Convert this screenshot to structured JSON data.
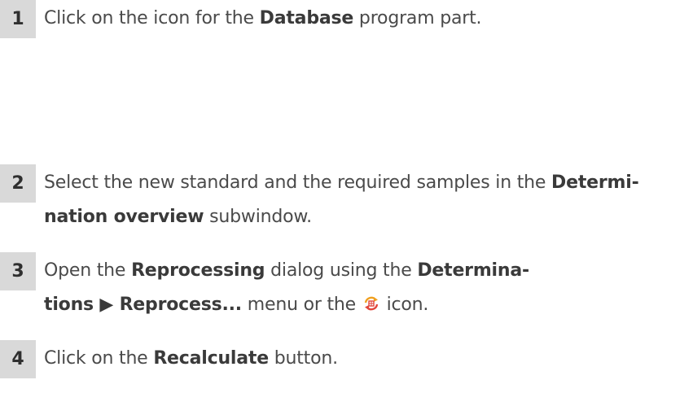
{
  "steps": [
    {
      "number": "1",
      "t1": "Click on the icon for the ",
      "b1": "Database",
      "t2": " program part."
    },
    {
      "number": "2",
      "t1": "Select the new standard and the required samples in the ",
      "b1": "Determi-",
      "b2": "nation overview",
      "t2": " subwindow."
    },
    {
      "number": "3",
      "t1": "Open the ",
      "b1": "Reprocessing",
      "t2": " dialog using the ",
      "b2": "Determina-",
      "b3": "tions ▶ Reprocess...",
      "t3": " menu or the ",
      "icon": "reprocess-icon",
      "t4": " icon."
    },
    {
      "number": "4",
      "t1": "Click on the ",
      "b1": "Recalculate",
      "t2": " button."
    }
  ],
  "colors": {
    "number_box": "#d9d9d9",
    "text": "#4a4a4a",
    "icon_orange": "#f0a020",
    "icon_red": "#e2463b"
  }
}
